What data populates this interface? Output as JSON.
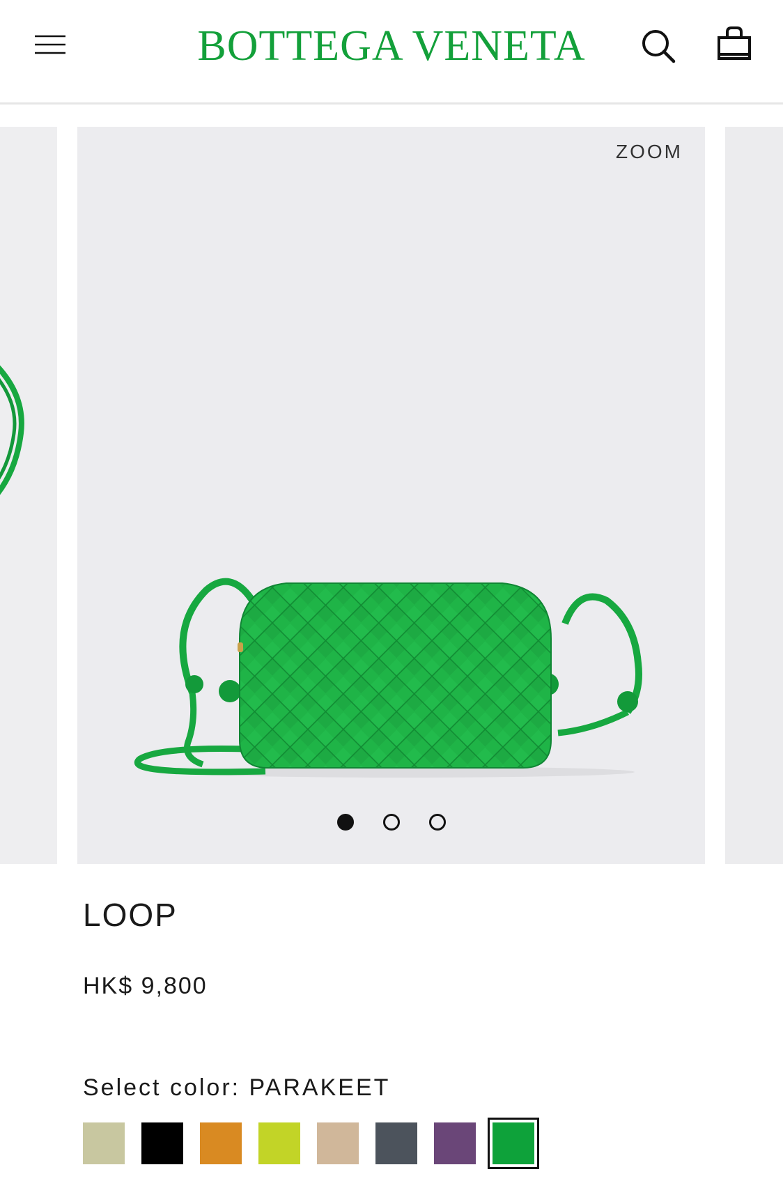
{
  "header": {
    "brand": "BOTTEGA VENETA",
    "brand_color": "#13a03a",
    "menu_icon": "hamburger-menu-icon",
    "search_icon": "search-icon",
    "bag_icon": "shopping-bag-icon"
  },
  "gallery": {
    "zoom_label": "ZOOM",
    "slide_count": 3,
    "active_slide": 1
  },
  "product": {
    "name": "LOOP",
    "price": "HK$ 9,800",
    "color_label": "Select color: PARAKEET",
    "colors": [
      {
        "hex": "#c8c7a0",
        "selected": false
      },
      {
        "hex": "#000000",
        "selected": false
      },
      {
        "hex": "#d98a22",
        "selected": false
      },
      {
        "hex": "#c2d427",
        "selected": false
      },
      {
        "hex": "#d0b79a",
        "selected": false
      },
      {
        "hex": "#4c535c",
        "selected": false
      },
      {
        "hex": "#6a4678",
        "selected": false
      },
      {
        "hex": "#0ea23a",
        "selected": true
      }
    ]
  }
}
